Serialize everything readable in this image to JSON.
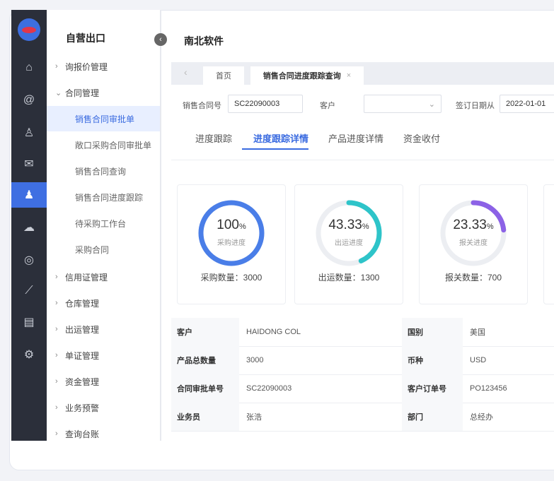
{
  "sidebar": {
    "brand": "自营出口",
    "menu": [
      {
        "label": "询报价管理",
        "expanded": false
      },
      {
        "label": "合同管理",
        "expanded": true
      }
    ],
    "contract_subitems": [
      "销售合同审批单",
      "敞口采购合同审批单",
      "销售合同查询",
      "销售合同进度跟踪",
      "待采购工作台",
      "采购合同"
    ],
    "more_menu": [
      "信用证管理",
      "仓库管理",
      "出运管理",
      "单证管理",
      "资金管理",
      "业务预警",
      "查询台账"
    ]
  },
  "header": {
    "company": "南北软件"
  },
  "tabs": {
    "home": "首页",
    "current": "销售合同进度跟踪查询",
    "close": "×"
  },
  "filters": {
    "contract_no_label": "销售合同号",
    "contract_no_value": "SC22090003",
    "customer_label": "客户",
    "customer_value": "",
    "date_label": "签订日期从",
    "date_value": "2022-01-01"
  },
  "subtabs": [
    "进度跟踪",
    "进度跟踪详情",
    "产品进度详情",
    "资金收付"
  ],
  "progress": [
    {
      "value": "100",
      "unit": "%",
      "label": "采购进度",
      "qty_label": "采购数量：",
      "qty": "3000",
      "pct": 1.0,
      "color": "#4a7ee8"
    },
    {
      "value": "43.33",
      "unit": "%",
      "label": "出运进度",
      "qty_label": "出运数量：",
      "qty": "1300",
      "pct": 0.4333,
      "color": "#2ec4c9"
    },
    {
      "value": "23.33",
      "unit": "%",
      "label": "报关进度",
      "qty_label": "报关数量：",
      "qty": "700",
      "pct": 0.2333,
      "color": "#8c62e6"
    }
  ],
  "info": {
    "customer_k": "客户",
    "customer_v": "HAIDONG COL",
    "country_k": "国别",
    "country_v": "美国",
    "qty_k": "产品总数量",
    "qty_v": "3000",
    "currency_k": "币种",
    "currency_v": "USD",
    "approval_k": "合同审批单号",
    "approval_v": "SC22090003",
    "order_k": "客户订单号",
    "order_v": "PO123456",
    "sales_k": "业务员",
    "sales_v": "张浩",
    "dept_k": "部门",
    "dept_v": "总经办"
  }
}
